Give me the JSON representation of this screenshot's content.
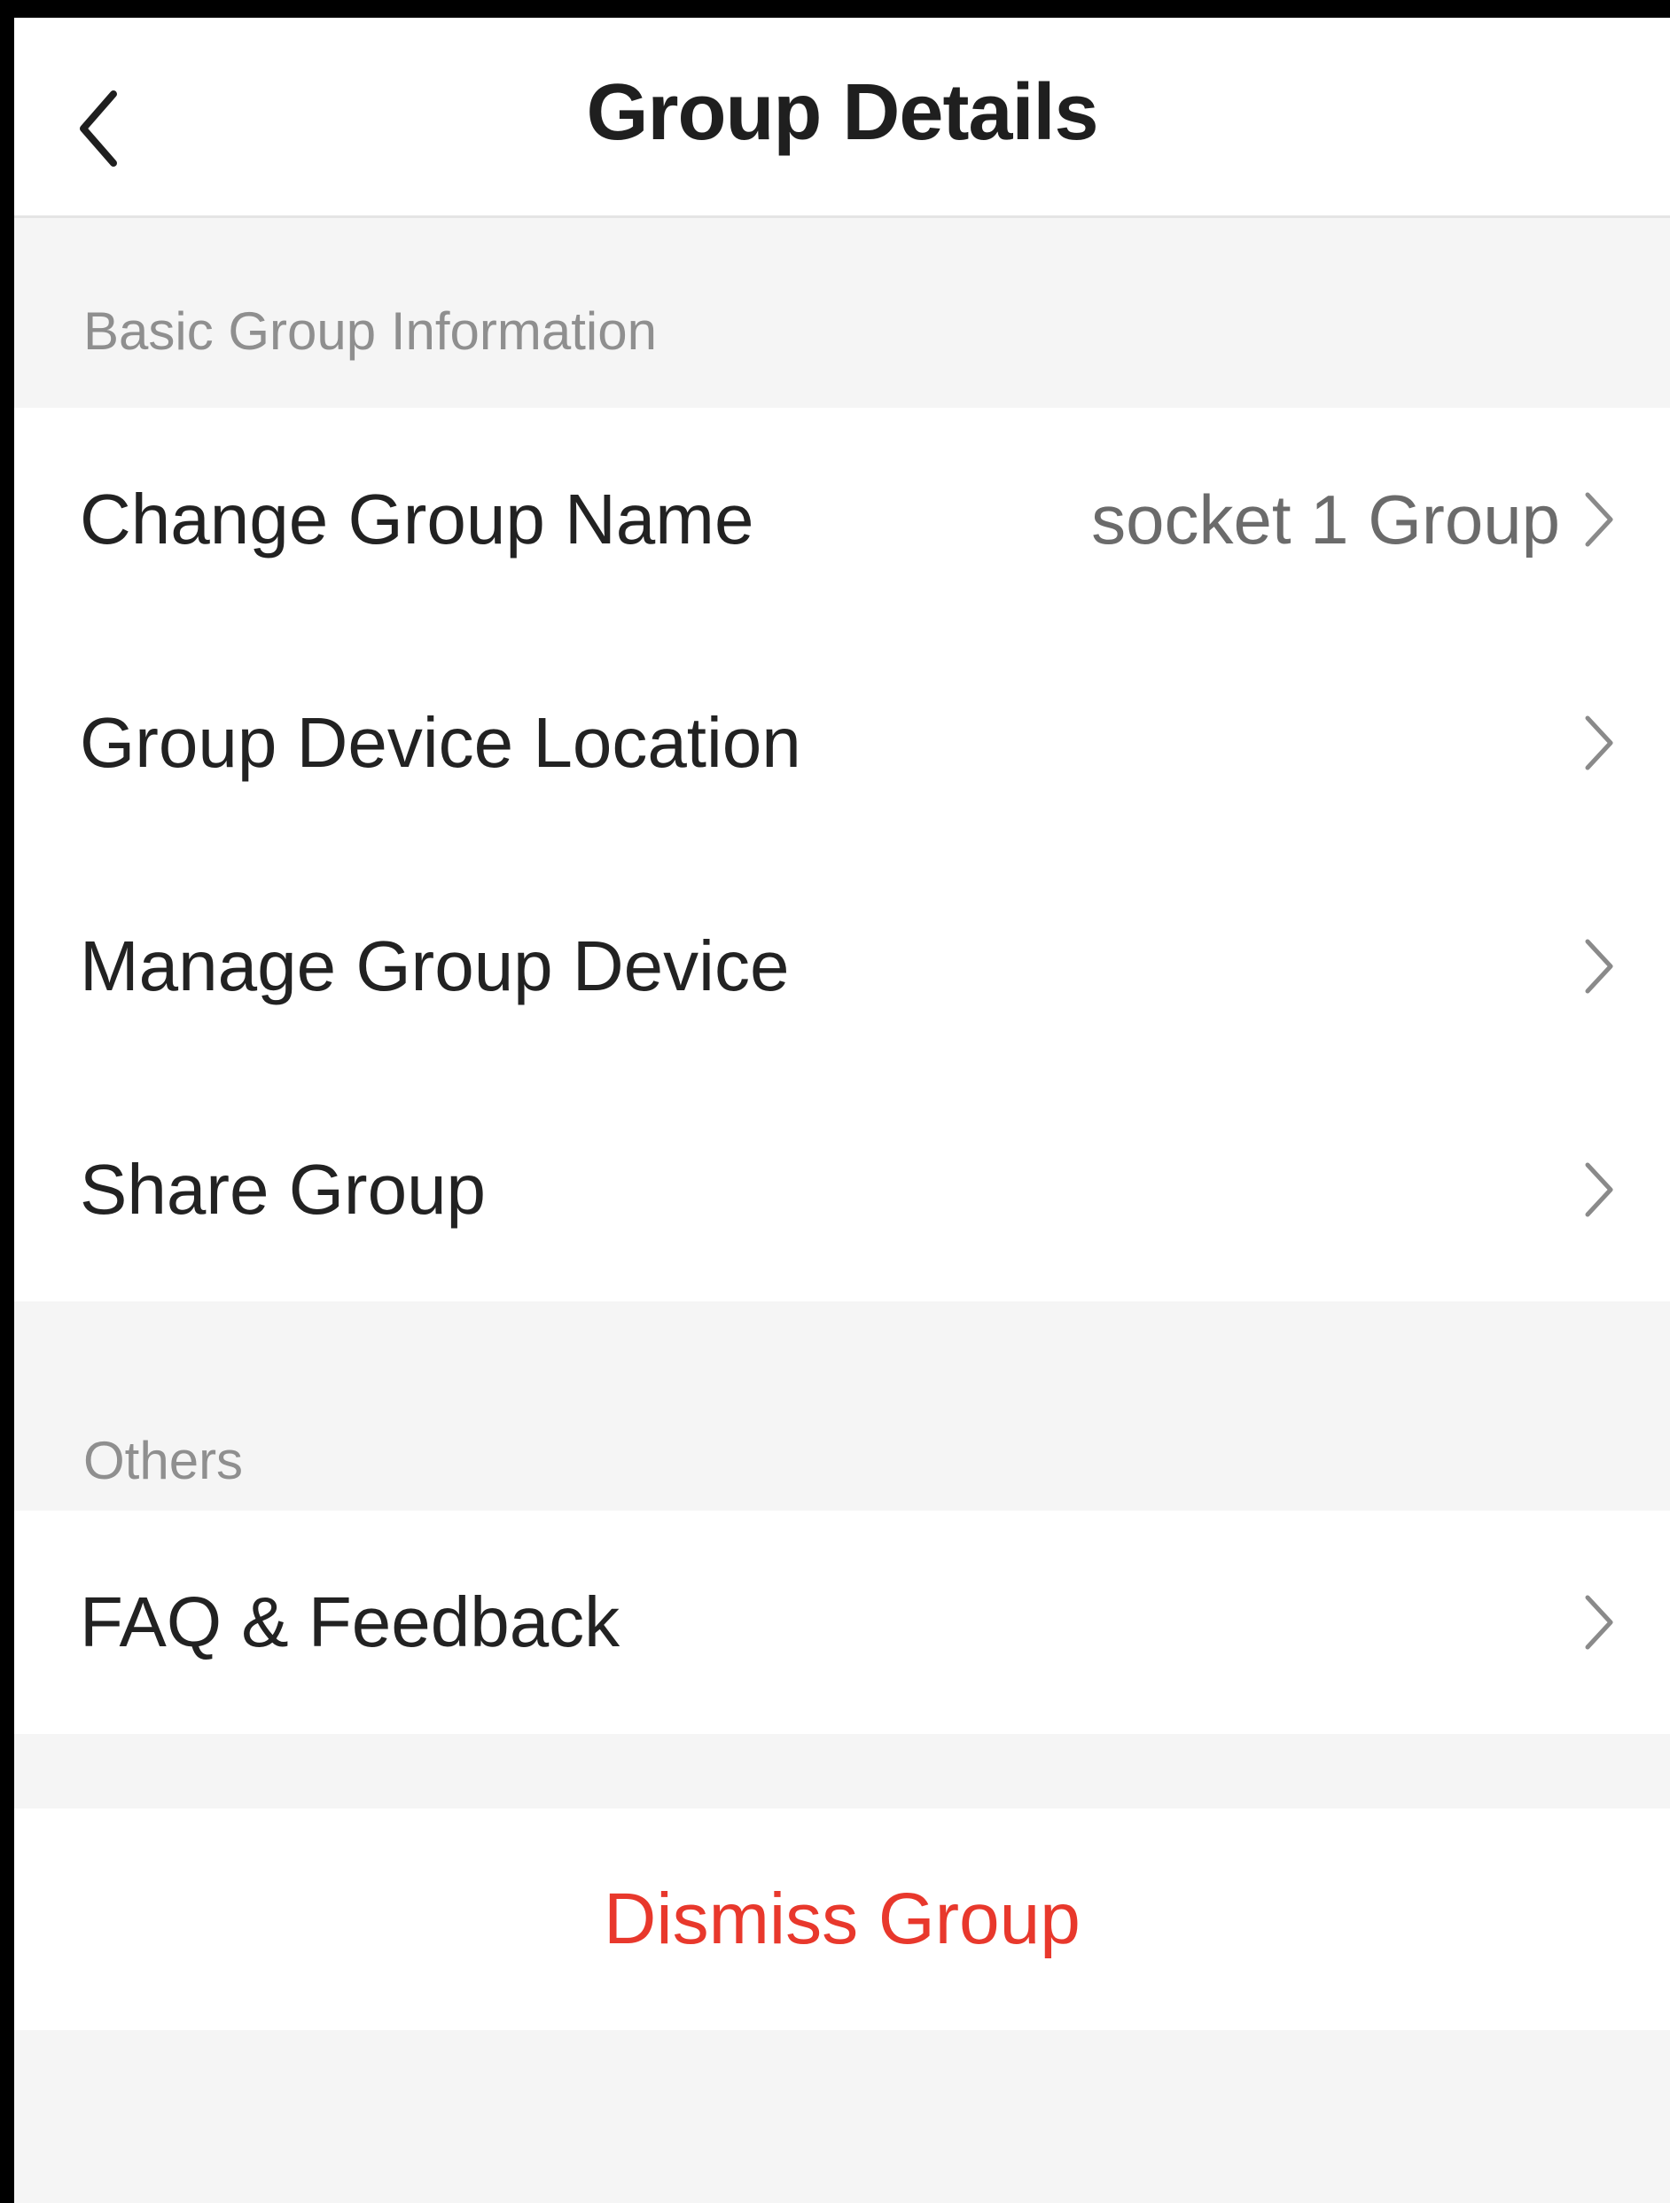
{
  "header": {
    "title": "Group Details",
    "back_icon": "chevron-left-icon"
  },
  "basic_section": {
    "label": "Basic Group Information",
    "items": [
      {
        "label": "Change Group Name",
        "value": "socket 1 Group"
      },
      {
        "label": "Group Device Location"
      },
      {
        "label": "Manage Group Device"
      },
      {
        "label": "Share Group"
      }
    ]
  },
  "others_section": {
    "label": "Others",
    "items": [
      {
        "label": "FAQ & Feedback"
      }
    ]
  },
  "dismiss": {
    "label": "Dismiss Group"
  },
  "colors": {
    "danger": "#e8382c",
    "background": "#f5f5f5",
    "surface": "#ffffff",
    "secondary_text": "#8f8f8f"
  }
}
